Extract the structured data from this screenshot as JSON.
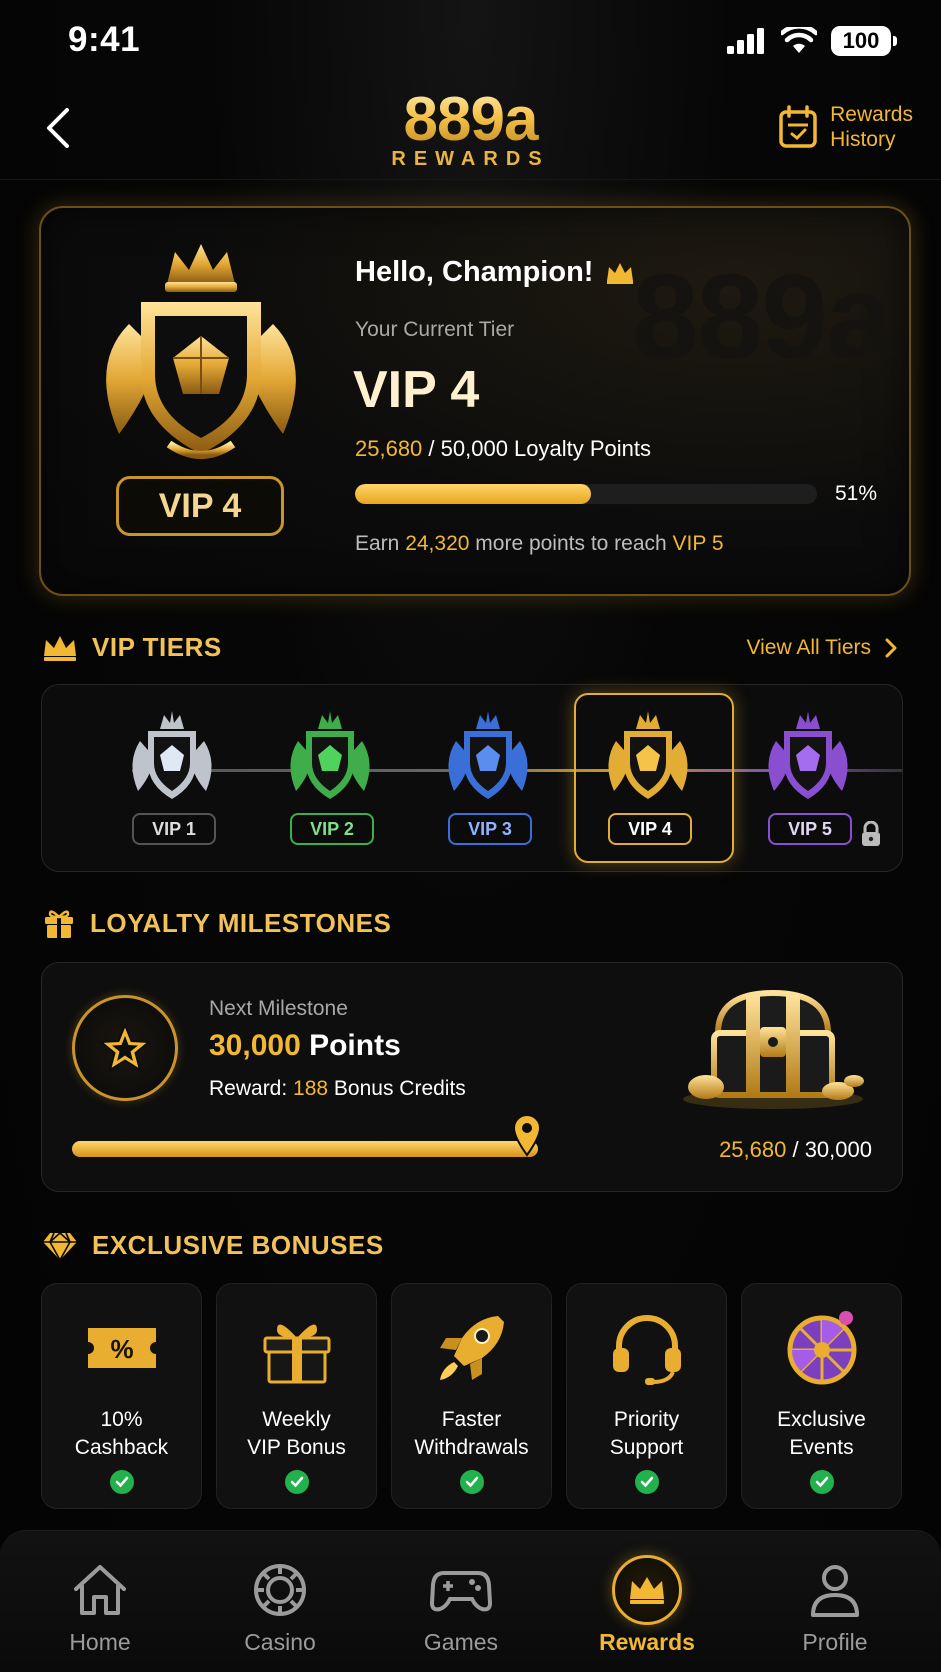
{
  "status_bar": {
    "time": "9:41",
    "battery": "100"
  },
  "header": {
    "brand": "889a",
    "brand_sub": "REWARDS",
    "history_line1": "Rewards",
    "history_line2": "History"
  },
  "hero": {
    "greeting": "Hello, Champion!",
    "caption": "Your Current Tier",
    "tier": "VIP 4",
    "badge_label": "VIP 4",
    "points_current": "25,680",
    "points_rest": " / 50,000 Loyalty Points",
    "progress_percent": 51,
    "progress_label": "51%",
    "earn_prefix": "Earn ",
    "earn_points": "24,320",
    "earn_mid": " more points to reach ",
    "earn_target": "VIP 5",
    "watermark": "889a"
  },
  "vip_tiers": {
    "title": "VIP TIERS",
    "view_all": "View All Tiers",
    "items": [
      {
        "label": "VIP 1",
        "color": "#bfc4cc",
        "gem": "#dfe8f4",
        "state": "unlocked"
      },
      {
        "label": "VIP 2",
        "color": "#3fae4a",
        "gem": "#4fd35c",
        "state": "unlocked"
      },
      {
        "label": "VIP 3",
        "color": "#3a6fd8",
        "gem": "#5b8cf0",
        "state": "unlocked"
      },
      {
        "label": "VIP 4",
        "color": "#e3ad35",
        "gem": "#f5c24a",
        "state": "current"
      },
      {
        "label": "VIP 5",
        "color": "#8a4fd0",
        "gem": "#a46cf0",
        "state": "locked"
      }
    ]
  },
  "milestones": {
    "title": "LOYALTY MILESTONES",
    "caption": "Next Milestone",
    "points_value": "30,000",
    "points_unit": " Points",
    "reward_prefix": "Reward: ",
    "reward_value": "188",
    "reward_suffix": " Bonus Credits",
    "count_current": "25,680",
    "count_rest": " / 30,000",
    "progress_fraction": 0.856
  },
  "bonuses": {
    "title": "EXCLUSIVE BONUSES",
    "items": [
      {
        "line1": "10%",
        "line2": "Cashback",
        "icon": "cashback-ticket-icon",
        "status": "active"
      },
      {
        "line1": "Weekly",
        "line2": "VIP Bonus",
        "icon": "gift-box-icon",
        "status": "active"
      },
      {
        "line1": "Faster",
        "line2": "Withdrawals",
        "icon": "rocket-icon",
        "status": "active"
      },
      {
        "line1": "Priority",
        "line2": "Support",
        "icon": "headset-icon",
        "status": "active"
      },
      {
        "line1": "Exclusive",
        "line2": "Events",
        "icon": "wheel-icon",
        "status": "active"
      }
    ]
  },
  "nav": {
    "items": [
      {
        "label": "Home",
        "icon": "home-icon"
      },
      {
        "label": "Casino",
        "icon": "chip-icon"
      },
      {
        "label": "Games",
        "icon": "gamepad-icon"
      },
      {
        "label": "Rewards",
        "icon": "crown-icon",
        "active": true
      },
      {
        "label": "Profile",
        "icon": "person-icon"
      }
    ]
  },
  "colors": {
    "accent": "#f2b733",
    "background": "#050505",
    "success": "#22b14c"
  }
}
